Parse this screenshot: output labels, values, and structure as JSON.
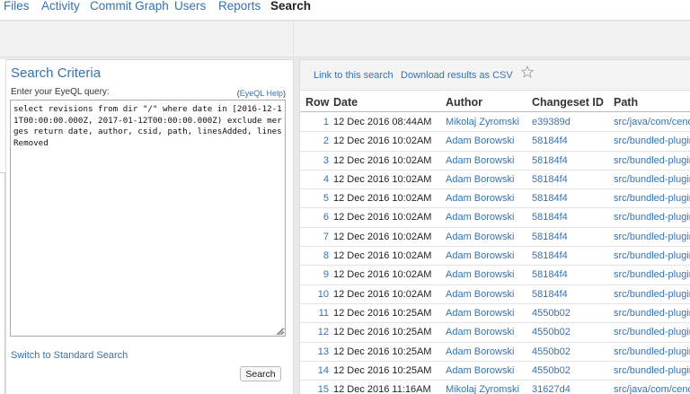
{
  "nav": {
    "tabs": [
      {
        "label": "Files"
      },
      {
        "label": "Activity"
      },
      {
        "label": "Commit Graph"
      },
      {
        "label": "Users"
      },
      {
        "label": "Reports"
      },
      {
        "label": "Search",
        "active": true
      }
    ]
  },
  "criteria": {
    "title": "Search Criteria",
    "query_label": "Enter your EyeQL query:",
    "help_open": "(",
    "help_link": "EyeQL Help",
    "help_close": ")",
    "query": "select revisions from dir \"/\" where date in [2016-12-11T00:00:00.000Z, 2017-01-12T00:00:00.000Z) exclude merges return date, author, csid, path, linesAdded, linesRemoved",
    "switch_link": "Switch to Standard Search",
    "search_button": "Search"
  },
  "results": {
    "link_to_search": "Link to this search",
    "download_csv": "Download results as CSV",
    "star_icon": "star-icon",
    "columns": {
      "row": "Row",
      "date": "Date",
      "author": "Author",
      "csid": "Changeset ID",
      "path": "Path"
    },
    "rows": [
      {
        "num": "1",
        "date": "12 Dec 2016 08:44AM",
        "author": "Mikolaj Zyromski",
        "csid": "e39389d",
        "path": "src/java/com/cenq"
      },
      {
        "num": "2",
        "date": "12 Dec 2016 10:02AM",
        "author": "Adam Borowski",
        "csid": "58184f4",
        "path": "src/bundled-plugin"
      },
      {
        "num": "3",
        "date": "12 Dec 2016 10:02AM",
        "author": "Adam Borowski",
        "csid": "58184f4",
        "path": "src/bundled-plugin"
      },
      {
        "num": "4",
        "date": "12 Dec 2016 10:02AM",
        "author": "Adam Borowski",
        "csid": "58184f4",
        "path": "src/bundled-plugin"
      },
      {
        "num": "5",
        "date": "12 Dec 2016 10:02AM",
        "author": "Adam Borowski",
        "csid": "58184f4",
        "path": "src/bundled-plugin"
      },
      {
        "num": "6",
        "date": "12 Dec 2016 10:02AM",
        "author": "Adam Borowski",
        "csid": "58184f4",
        "path": "src/bundled-plugin"
      },
      {
        "num": "7",
        "date": "12 Dec 2016 10:02AM",
        "author": "Adam Borowski",
        "csid": "58184f4",
        "path": "src/bundled-plugin"
      },
      {
        "num": "8",
        "date": "12 Dec 2016 10:02AM",
        "author": "Adam Borowski",
        "csid": "58184f4",
        "path": "src/bundled-plugin"
      },
      {
        "num": "9",
        "date": "12 Dec 2016 10:02AM",
        "author": "Adam Borowski",
        "csid": "58184f4",
        "path": "src/bundled-plugin"
      },
      {
        "num": "10",
        "date": "12 Dec 2016 10:02AM",
        "author": "Adam Borowski",
        "csid": "58184f4",
        "path": "src/bundled-plugin"
      },
      {
        "num": "11",
        "date": "12 Dec 2016 10:25AM",
        "author": "Adam Borowski",
        "csid": "4550b02",
        "path": "src/bundled-plugin"
      },
      {
        "num": "12",
        "date": "12 Dec 2016 10:25AM",
        "author": "Adam Borowski",
        "csid": "4550b02",
        "path": "src/bundled-plugin"
      },
      {
        "num": "13",
        "date": "12 Dec 2016 10:25AM",
        "author": "Adam Borowski",
        "csid": "4550b02",
        "path": "src/bundled-plugin"
      },
      {
        "num": "14",
        "date": "12 Dec 2016 10:25AM",
        "author": "Adam Borowski",
        "csid": "4550b02",
        "path": "src/bundled-plugin"
      },
      {
        "num": "15",
        "date": "12 Dec 2016 11:16AM",
        "author": "Mikolaj Zyromski",
        "csid": "31627d4",
        "path": "src/java/com/cenq"
      }
    ]
  }
}
